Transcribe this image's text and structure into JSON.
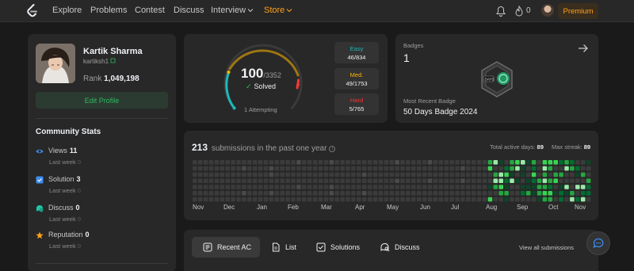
{
  "nav": {
    "items": [
      "Explore",
      "Problems",
      "Contest",
      "Discuss",
      "Interview",
      "Store"
    ],
    "notif_count": "0",
    "premium_label": "Premium"
  },
  "profile": {
    "name": "Kartik Sharma",
    "username": "kartiksh1",
    "rank_label": "Rank",
    "rank_value": "1,049,198",
    "edit_label": "Edit Profile"
  },
  "community": {
    "title": "Community Stats",
    "stats": [
      {
        "label": "Views",
        "value": "11",
        "sub": "Last week",
        "sub_value": "0",
        "icon": "eye-icon",
        "color": "#3d8cf0"
      },
      {
        "label": "Solution",
        "value": "3",
        "sub": "Last week",
        "sub_value": "0",
        "icon": "solution-icon",
        "color": "#3d8cf0"
      },
      {
        "label": "Discuss",
        "value": "0",
        "sub": "Last week",
        "sub_value": "0",
        "icon": "discuss-icon",
        "color": "#22c5a8"
      },
      {
        "label": "Reputation",
        "value": "0",
        "sub": "Last week",
        "sub_value": "0",
        "icon": "star-icon",
        "color": "#ffa116"
      }
    ]
  },
  "solved": {
    "count": "100",
    "total": "/3352",
    "label": "Solved",
    "attempting": "1 Attempting",
    "difficulties": [
      {
        "name": "Easy",
        "value": "46/834",
        "color": "#1cbaba"
      },
      {
        "name": "Med.",
        "value": "49/1753",
        "color": "#ffb700"
      },
      {
        "name": "Hard",
        "value": "5/765",
        "color": "#f63737"
      }
    ]
  },
  "badges": {
    "label": "Badges",
    "count": "1",
    "recent_label": "Most Recent Badge",
    "recent_name": "50 Days Badge 2024",
    "badge_text": "DAYS"
  },
  "submissions": {
    "count": "213",
    "text": "submissions in the past one year",
    "active_label": "Total active days:",
    "active_value": "89",
    "streak_label": "Max streak:",
    "streak_value": "89",
    "months": [
      "Nov",
      "Dec",
      "Jan",
      "Feb",
      "Mar",
      "Apr",
      "May",
      "Jun",
      "Jul",
      "Aug",
      "Sep",
      "Oct",
      "Nov"
    ]
  },
  "tabs": {
    "items": [
      "Recent AC",
      "List",
      "Solutions",
      "Discuss"
    ],
    "view_all": "View all submissions"
  },
  "colors": {
    "accent": "#ffa116",
    "green": "#2cbb5d",
    "card": "#282828",
    "bg": "#1a1a1a"
  }
}
